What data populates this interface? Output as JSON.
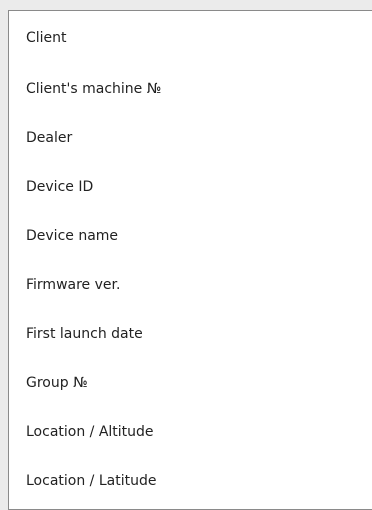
{
  "dropdown": {
    "options": [
      "Client",
      "Client's machine №",
      "Dealer",
      "Device ID",
      "Device name",
      "Firmware ver.",
      "First launch date",
      "Group №",
      "Location / Altitude",
      "Location / Latitude"
    ]
  }
}
